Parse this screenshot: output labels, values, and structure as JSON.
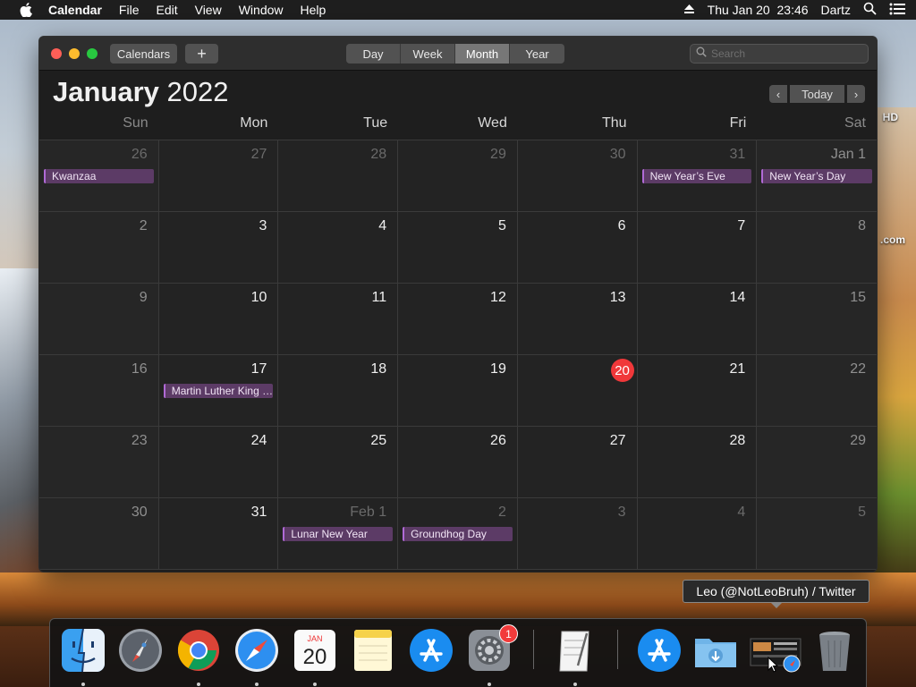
{
  "menubar": {
    "app_name": "Calendar",
    "menus": [
      "File",
      "Edit",
      "View",
      "Window",
      "Help"
    ],
    "clock": "Thu Jan 20  23:46",
    "user": "Dartz"
  },
  "desktop": {
    "label_hd": "HD",
    "label_com": ".com"
  },
  "toolbar": {
    "calendars_label": "Calendars",
    "add_label": "+",
    "views": [
      "Day",
      "Week",
      "Month",
      "Year"
    ],
    "active_view": "Month",
    "search_placeholder": "Search"
  },
  "header": {
    "month": "January",
    "year": "2022",
    "today_label": "Today",
    "prev_label": "‹",
    "next_label": "›"
  },
  "weekdays": [
    "Sun",
    "Mon",
    "Tue",
    "Wed",
    "Thu",
    "Fri",
    "Sat"
  ],
  "weeks": [
    [
      {
        "d": "26",
        "other": true,
        "event": "Kwanzaa"
      },
      {
        "d": "27",
        "other": true
      },
      {
        "d": "28",
        "other": true
      },
      {
        "d": "29",
        "other": true
      },
      {
        "d": "30",
        "other": true
      },
      {
        "d": "31",
        "other": true,
        "event": "New Year’s Eve"
      },
      {
        "d": "Jan 1",
        "event": "New Year’s Day"
      }
    ],
    [
      {
        "d": "2"
      },
      {
        "d": "3"
      },
      {
        "d": "4"
      },
      {
        "d": "5"
      },
      {
        "d": "6"
      },
      {
        "d": "7"
      },
      {
        "d": "8"
      }
    ],
    [
      {
        "d": "9"
      },
      {
        "d": "10"
      },
      {
        "d": "11"
      },
      {
        "d": "12"
      },
      {
        "d": "13"
      },
      {
        "d": "14"
      },
      {
        "d": "15"
      }
    ],
    [
      {
        "d": "16"
      },
      {
        "d": "17",
        "event": "Martin Luther King Jr. Day"
      },
      {
        "d": "18"
      },
      {
        "d": "19"
      },
      {
        "d": "20",
        "today": true
      },
      {
        "d": "21"
      },
      {
        "d": "22"
      }
    ],
    [
      {
        "d": "23"
      },
      {
        "d": "24"
      },
      {
        "d": "25"
      },
      {
        "d": "26"
      },
      {
        "d": "27"
      },
      {
        "d": "28"
      },
      {
        "d": "29"
      }
    ],
    [
      {
        "d": "30"
      },
      {
        "d": "31"
      },
      {
        "d": "Feb 1",
        "other": true,
        "event": "Lunar New Year"
      },
      {
        "d": "2",
        "other": true,
        "event": "Groundhog Day"
      },
      {
        "d": "3",
        "other": true
      },
      {
        "d": "4",
        "other": true
      },
      {
        "d": "5",
        "other": true
      }
    ]
  ],
  "tooltip": "Leo (@NotLeoBruh) / Twitter",
  "dock": {
    "calendar_month": "JAN",
    "calendar_day": "20",
    "settings_badge": "1",
    "apps": [
      "finder-icon",
      "launchpad-icon",
      "chrome-icon",
      "safari-icon",
      "calendar-icon",
      "notes-icon",
      "app-store-icon",
      "system-preferences-icon",
      "textedit-icon",
      "app-store-folder-icon",
      "downloads-folder-icon",
      "twitter-window-icon",
      "trash-icon"
    ]
  },
  "colors": {
    "today": "#f0383a",
    "event_bg": "#5c3b66",
    "event_accent": "#b06ad6",
    "window_bg": "#1e1e1e"
  }
}
